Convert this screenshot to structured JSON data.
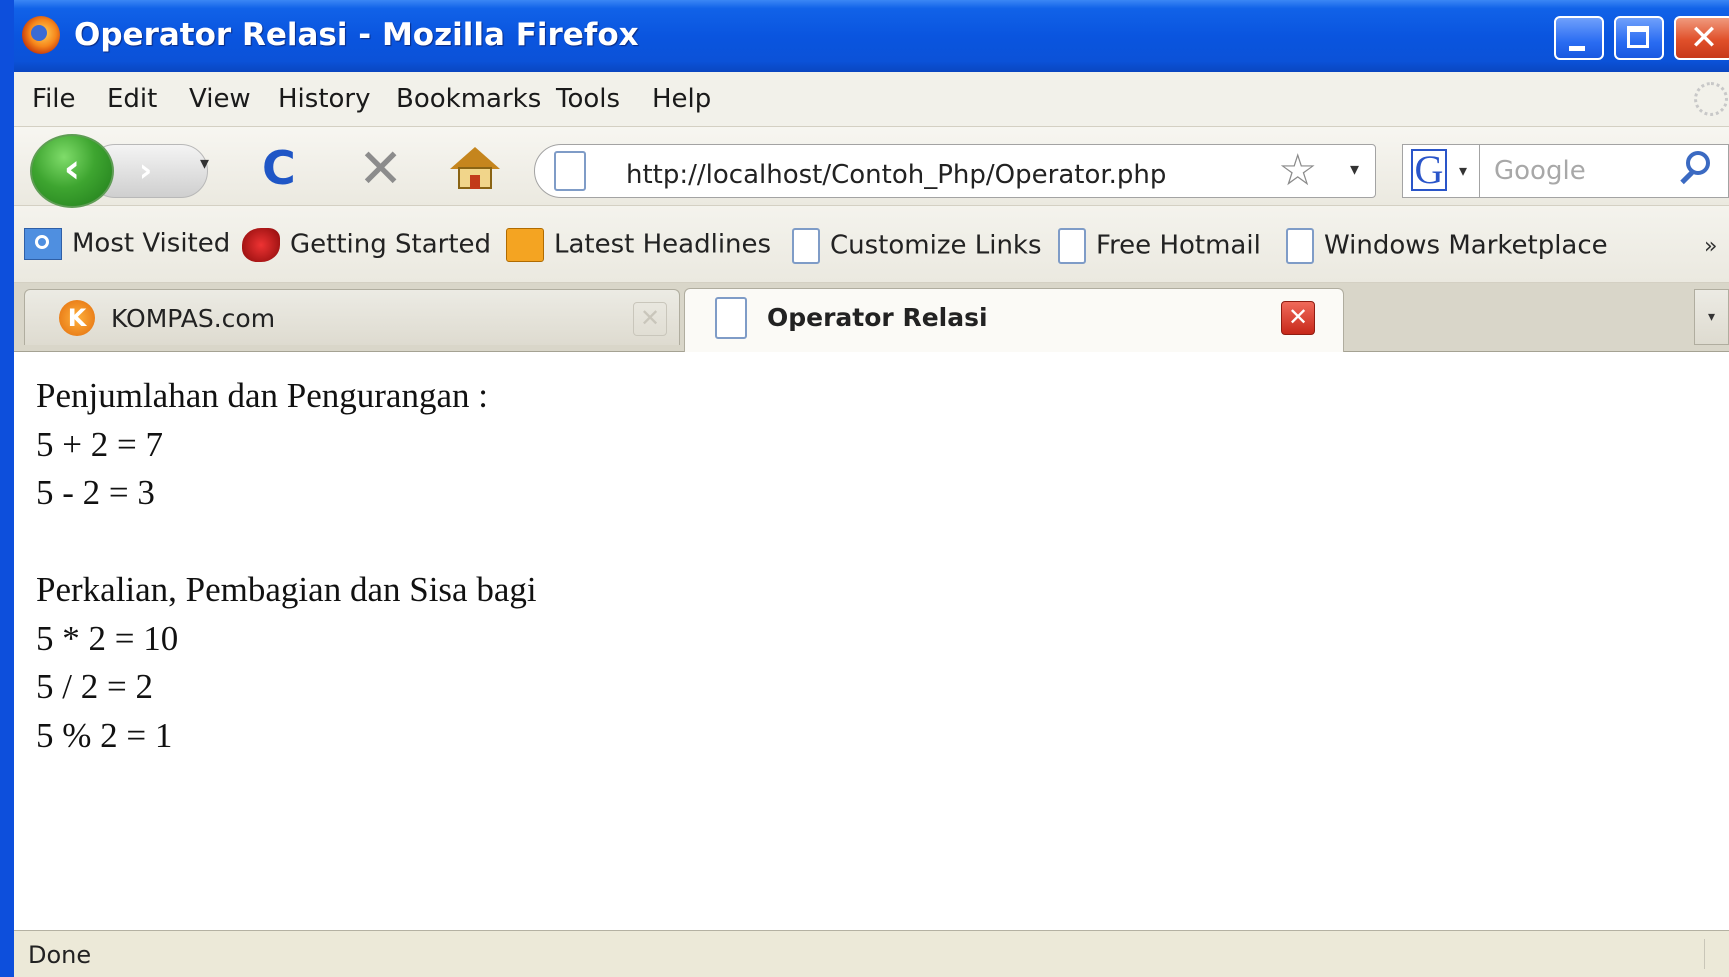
{
  "window": {
    "title": "Operator Relasi - Mozilla Firefox",
    "controls": {
      "minimize": "minimize",
      "maximize": "maximize",
      "close": "✕"
    }
  },
  "menu": {
    "items": [
      "File",
      "Edit",
      "View",
      "History",
      "Bookmarks",
      "Tools",
      "Help"
    ]
  },
  "navigation": {
    "back_glyph": "‹",
    "forward_glyph": "›",
    "reload_glyph": "C",
    "stop_glyph": "✕",
    "url": "http://localhost/Contoh_Php/Operator.php",
    "star_glyph": "☆",
    "dropdown_glyph": "▾",
    "search_engine_letter": "G",
    "search_placeholder": "Google"
  },
  "bookmarks": {
    "items": [
      {
        "label": "Most Visited",
        "icon": "most-visited-icon"
      },
      {
        "label": "Getting Started",
        "icon": "getting-started-icon"
      },
      {
        "label": "Latest Headlines",
        "icon": "rss-icon"
      },
      {
        "label": "Customize Links",
        "icon": "page-icon"
      },
      {
        "label": "Free Hotmail",
        "icon": "page-icon"
      },
      {
        "label": "Windows Marketplace",
        "icon": "page-icon"
      }
    ],
    "overflow": "»"
  },
  "tabs": [
    {
      "label": "KOMPAS.com",
      "active": false,
      "favicon_letter": "K"
    },
    {
      "label": "Operator Relasi",
      "active": true
    }
  ],
  "tab_close_glyph": "✕",
  "tab_list_glyph": "▾",
  "content": {
    "section1_title": "Penjumlahan dan Pengurangan :",
    "section1_lines": [
      "5 + 2 = 7",
      "5 - 2 = 3"
    ],
    "section2_title": "Perkalian, Pembagian dan Sisa bagi",
    "section2_lines": [
      "5 * 2 = 10",
      "5 / 2 = 2",
      "5 % 2 = 1"
    ]
  },
  "status": {
    "text": "Done"
  },
  "colors": {
    "titlebar": "#0a55df",
    "chrome": "#ece9d8",
    "close_red": "#e0502a",
    "back_green": "#3ea530"
  }
}
